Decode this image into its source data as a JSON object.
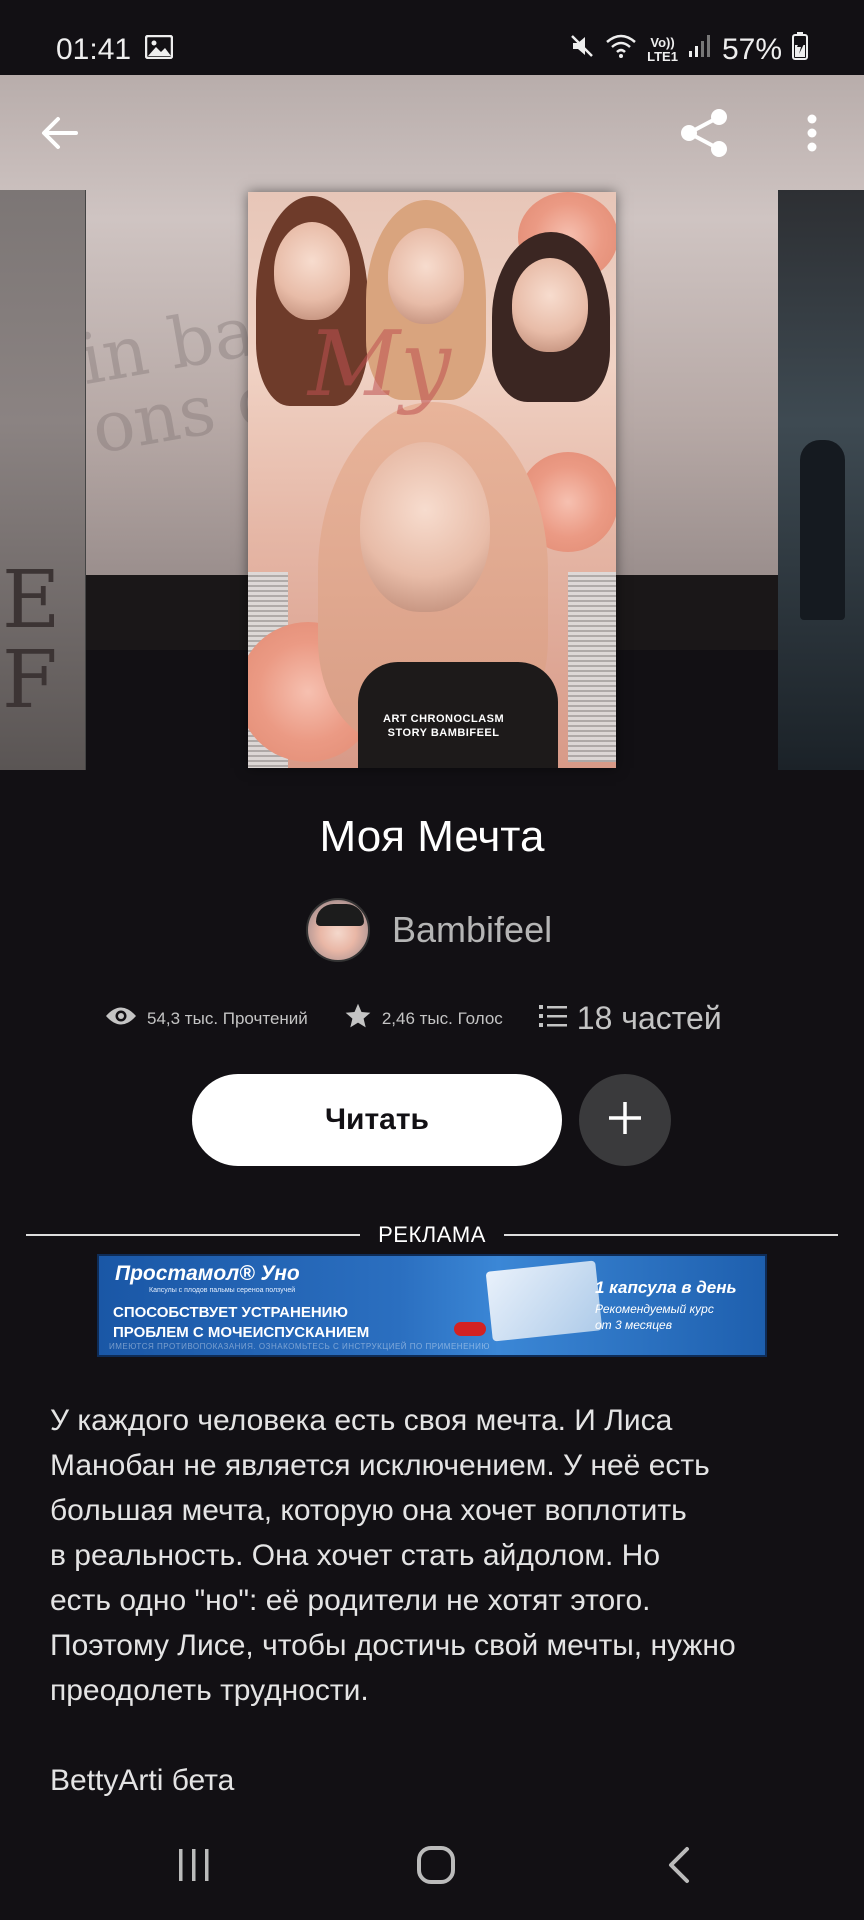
{
  "status_bar": {
    "time": "01:41",
    "battery": "57%",
    "network_label_1": "Vo))",
    "network_label_2": "LTE1",
    "icons": [
      "gallery-icon",
      "mute-icon",
      "wifi-icon",
      "signal-icon",
      "battery-icon"
    ]
  },
  "top_bar": {
    "icons": [
      "back-arrow-icon",
      "share-icon",
      "more-vertical-icon"
    ]
  },
  "cover": {
    "background_text_1": "in ba",
    "background_text_2": "ons on",
    "left_cover_text_1": "E",
    "left_cover_text_2": "F",
    "script": "My",
    "caption_1": "ART CHRONOCLASM",
    "caption_2": "STORY BAMBIFEEL"
  },
  "story": {
    "title": "Моя Мечта",
    "author": "Bambifeel",
    "reads": "54,3 тыс. Прочтений",
    "votes": "2,46 тыс. Голос",
    "parts": "18 частей"
  },
  "actions": {
    "read_label": "Читать",
    "add_icon": "plus-icon"
  },
  "ad": {
    "label": "РЕКЛАМА",
    "brand": "Простамол® Уно",
    "subbrand": "Капсулы с плодов пальмы сереноа ползучей",
    "line1": "СПОСОБСТВУЕТ УСТРАНЕНИЮ",
    "line2": "ПРОБЛЕМ С МОЧЕИСПУСКАНИЕМ",
    "right1": "1 капсула в день",
    "right2": "Рекомендуемый курс",
    "right3": "от 3 месяцев",
    "footer": "ИМЕЮТСЯ ПРОТИВОПОКАЗАНИЯ. ОЗНАКОМЬТЕСЬ С ИНСТРУКЦИЕЙ ПО ПРИМЕНЕНИЮ",
    "colors": {
      "background": "#2b6fc0",
      "pill": "#d32222"
    }
  },
  "description": {
    "lines": [
      "У каждого человека есть своя мечта. И Лиса",
      "Манобан не является исключением. У неё есть",
      "большая мечта, которую она хочет воплотить",
      "в реальность. Она хочет стать айдолом. Но",
      "есть одно \"но\": её родители не хотят этого.",
      "Поэтому Лисе, чтобы достичь свой мечты, нужно",
      "преодолеть трудности."
    ],
    "credit": "BettyArti бета"
  },
  "nav_bar": {
    "icons": [
      "recent-apps-icon",
      "home-icon",
      "back-icon"
    ]
  }
}
